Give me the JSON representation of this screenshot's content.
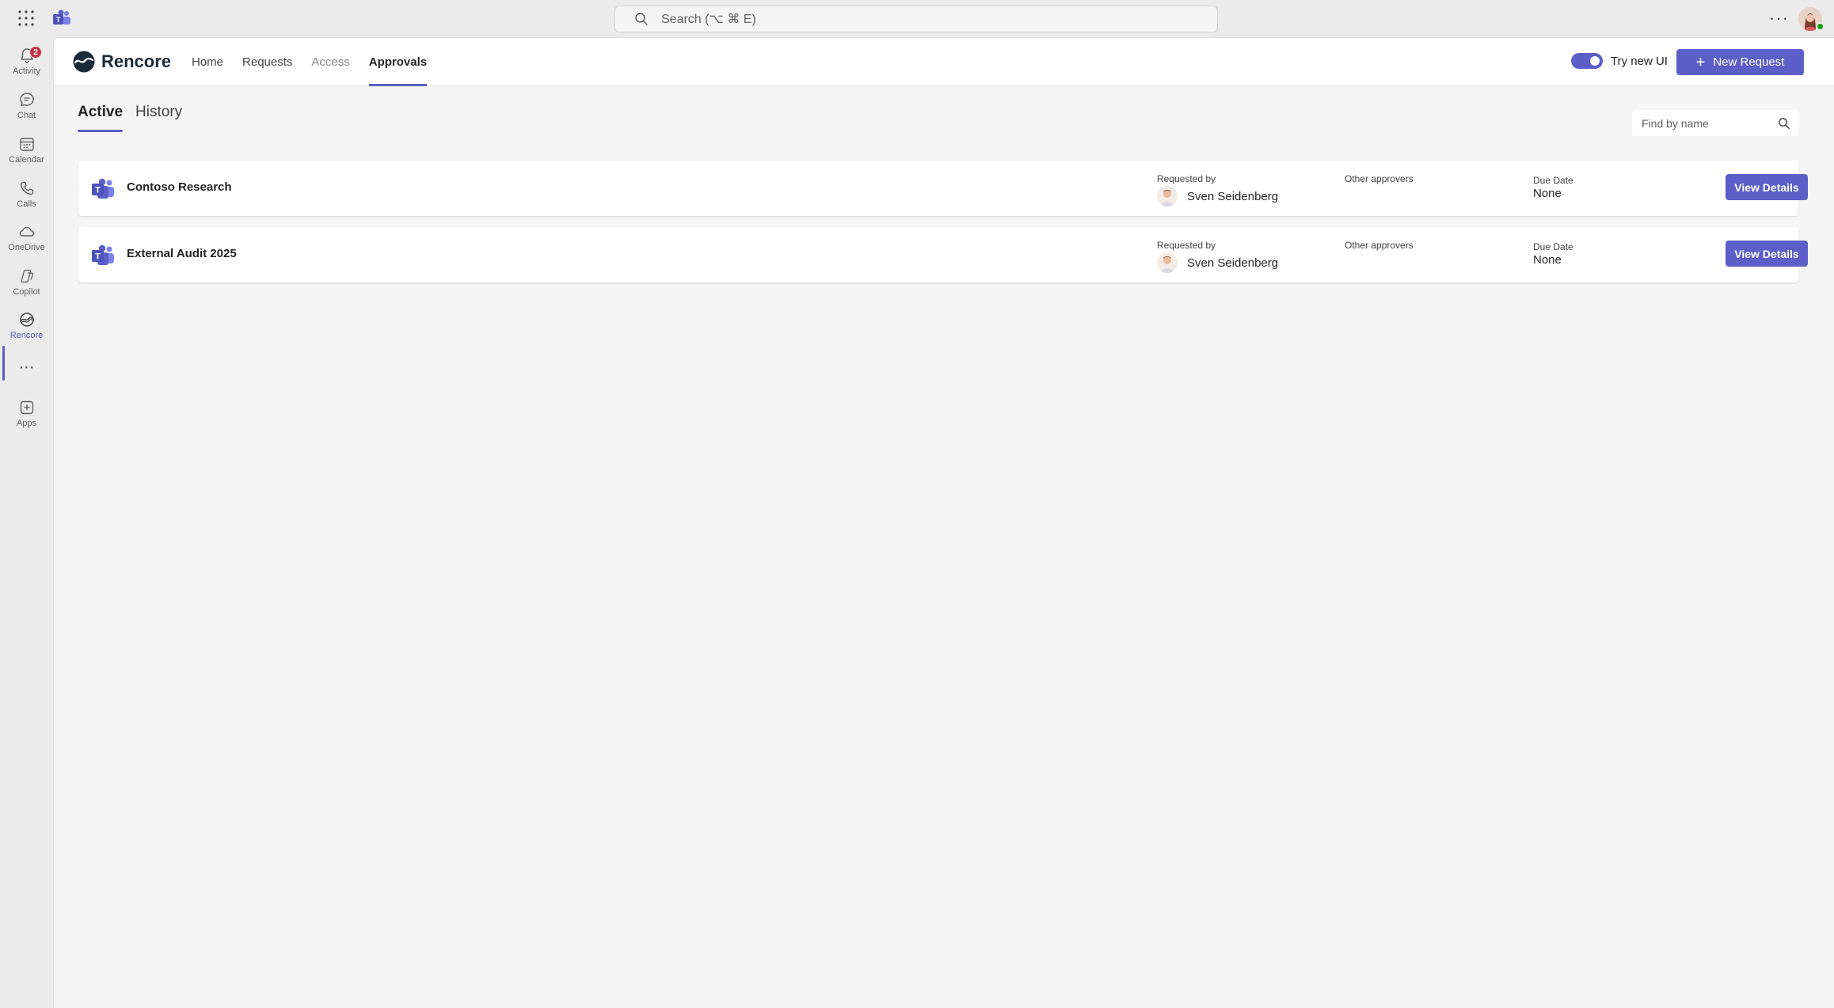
{
  "topbar": {
    "search_placeholder": "Search (⌥ ⌘ E)",
    "more_label": "···"
  },
  "rail": {
    "items": [
      {
        "label": "Activity",
        "icon": "bell-icon",
        "badge": "2"
      },
      {
        "label": "Chat",
        "icon": "chat-icon"
      },
      {
        "label": "Calendar",
        "icon": "calendar-icon"
      },
      {
        "label": "Calls",
        "icon": "phone-icon"
      },
      {
        "label": "OneDrive",
        "icon": "cloud-icon"
      },
      {
        "label": "Copilot",
        "icon": "copilot-icon"
      },
      {
        "label": "Rencore",
        "icon": "rencore-icon",
        "active": true
      },
      {
        "label": "Apps",
        "icon": "add-app-icon"
      }
    ],
    "more_label": "···"
  },
  "header": {
    "brand": "Rencore",
    "nav": [
      {
        "label": "Home"
      },
      {
        "label": "Requests"
      },
      {
        "label": "Access",
        "disabled": true
      },
      {
        "label": "Approvals",
        "active": true
      }
    ],
    "toggle_label": "Try new UI",
    "toggle_on": true,
    "new_request_label": "New Request"
  },
  "tabs": [
    {
      "label": "Active",
      "active": true
    },
    {
      "label": "History"
    }
  ],
  "find": {
    "placeholder": "Find by name"
  },
  "approvals": [
    {
      "name": "Contoso Research",
      "requested_by_label": "Requested by",
      "requested_by": "Sven Seidenberg",
      "other_approvers_label": "Other approvers",
      "due_date_label": "Due Date",
      "due_date": "None",
      "button": "View Details"
    },
    {
      "name": "External Audit 2025",
      "requested_by_label": "Requested by",
      "requested_by": "Sven Seidenberg",
      "other_approvers_label": "Other approvers",
      "due_date_label": "Due Date",
      "due_date": "None",
      "button": "View Details"
    }
  ],
  "colors": {
    "accent": "#5b5fc7",
    "badge": "#c4314b",
    "presence": "#13a10e"
  }
}
